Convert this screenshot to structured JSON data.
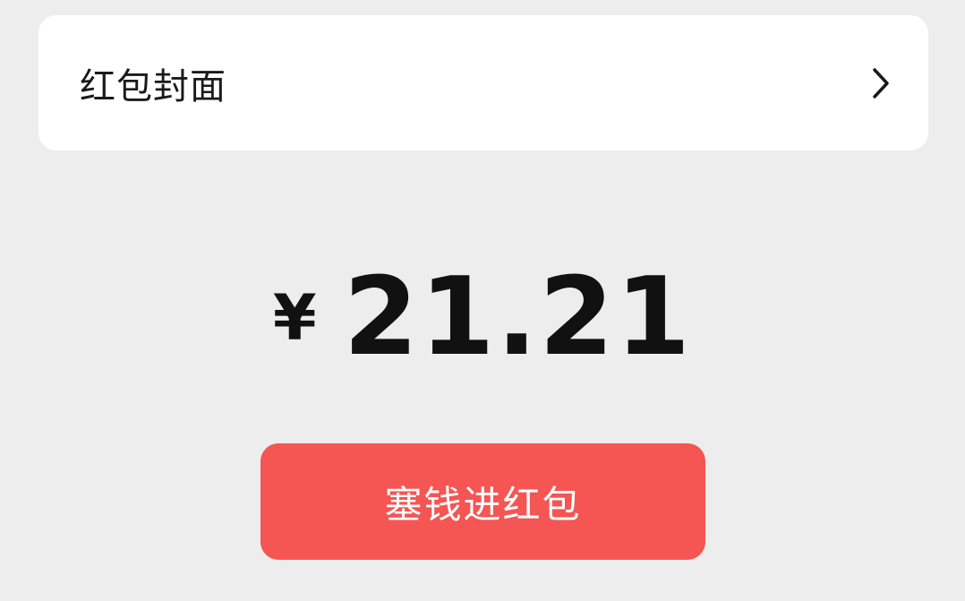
{
  "cover_row": {
    "label": "红包封面",
    "chevron_icon": "chevron-right-icon"
  },
  "amount": {
    "currency_symbol": "¥",
    "value": "21.21"
  },
  "send_button": {
    "label": "塞钱进红包"
  },
  "colors": {
    "background": "#ededed",
    "card": "#ffffff",
    "button": "#f55553",
    "text": "#111111"
  }
}
